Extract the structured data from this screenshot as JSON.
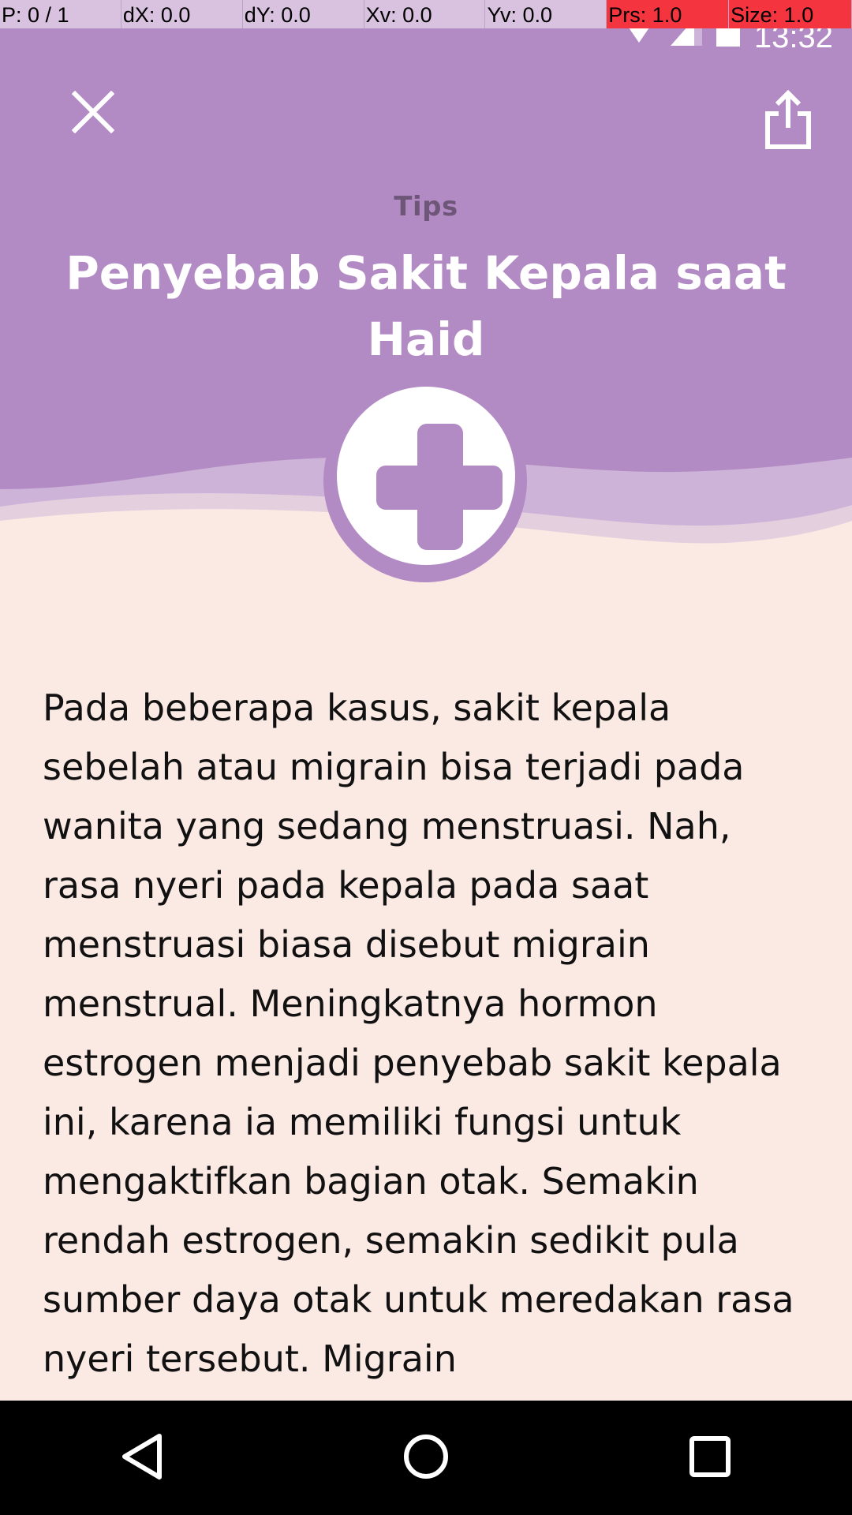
{
  "debug": {
    "pointer": "P: 0 / 1",
    "dx": "dX: 0.0",
    "dy": "dY: 0.0",
    "xv": "Xv: 0.0",
    "yv": "Yv: 0.0",
    "prs": "Prs: 1.0",
    "size": "Size: 1.0"
  },
  "status_bar": {
    "time": "13:32",
    "icons": [
      "wifi-icon",
      "signal-icon",
      "battery-icon"
    ]
  },
  "header": {
    "close_icon": "close-icon",
    "share_icon": "share-icon",
    "category": "Tips",
    "title": "Penyebab Sakit Kepala saat Haid",
    "badge_icon": "medical-cross-icon"
  },
  "article": {
    "body": "Pada beberapa kasus, sakit kepala sebelah atau migrain bisa terjadi pada wanita yang sedang menstruasi. Nah, rasa nyeri pada kepala pada saat menstruasi biasa disebut migrain menstrual. Meningkatnya hormon estrogen menjadi penyebab sakit kepala ini, karena ia memiliki fungsi untuk mengaktifkan bagian otak. Semakin rendah estrogen, semakin sedikit pula sumber daya otak untuk meredakan rasa nyeri tersebut. Migrain"
  },
  "nav": {
    "back_icon": "back-icon",
    "home_icon": "home-icon",
    "recents_icon": "recents-icon"
  },
  "colors": {
    "header": "#B38BC4",
    "background": "#FBE9E4",
    "category_text": "#6E5679",
    "debug_bar": "#D8C2DF",
    "debug_highlight": "#F4343E"
  }
}
